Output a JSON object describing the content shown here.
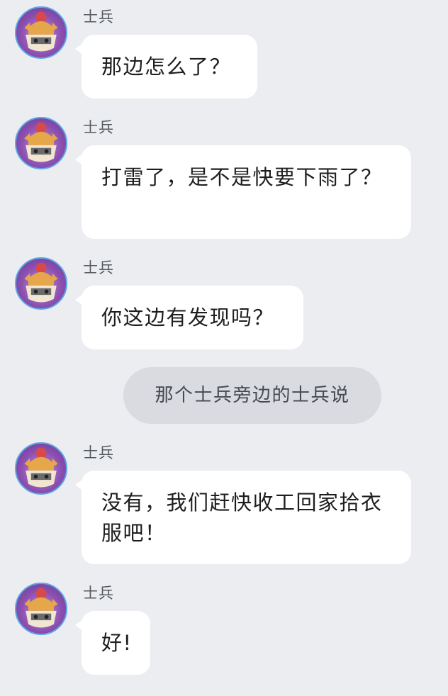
{
  "messages": [
    {
      "sender": "士兵",
      "text": "那边怎么了？"
    },
    {
      "sender": "士兵",
      "text": "打雷了，是不是快要下雨了？"
    },
    {
      "sender": "士兵",
      "text": "你这边有发现吗？"
    },
    {
      "sender": "士兵",
      "text": "没有，我们赶快收工回家拾衣服吧！"
    },
    {
      "sender": "士兵",
      "text": "好!"
    }
  ],
  "system_notice": "那个士兵旁边的士兵说",
  "avatar": {
    "icon": "cat-soldier-avatar-icon"
  },
  "colors": {
    "background": "#ebedf0",
    "bubble": "#ffffff",
    "system_pill": "#d9dbe1",
    "avatar_ring": "#5aa6e6"
  }
}
